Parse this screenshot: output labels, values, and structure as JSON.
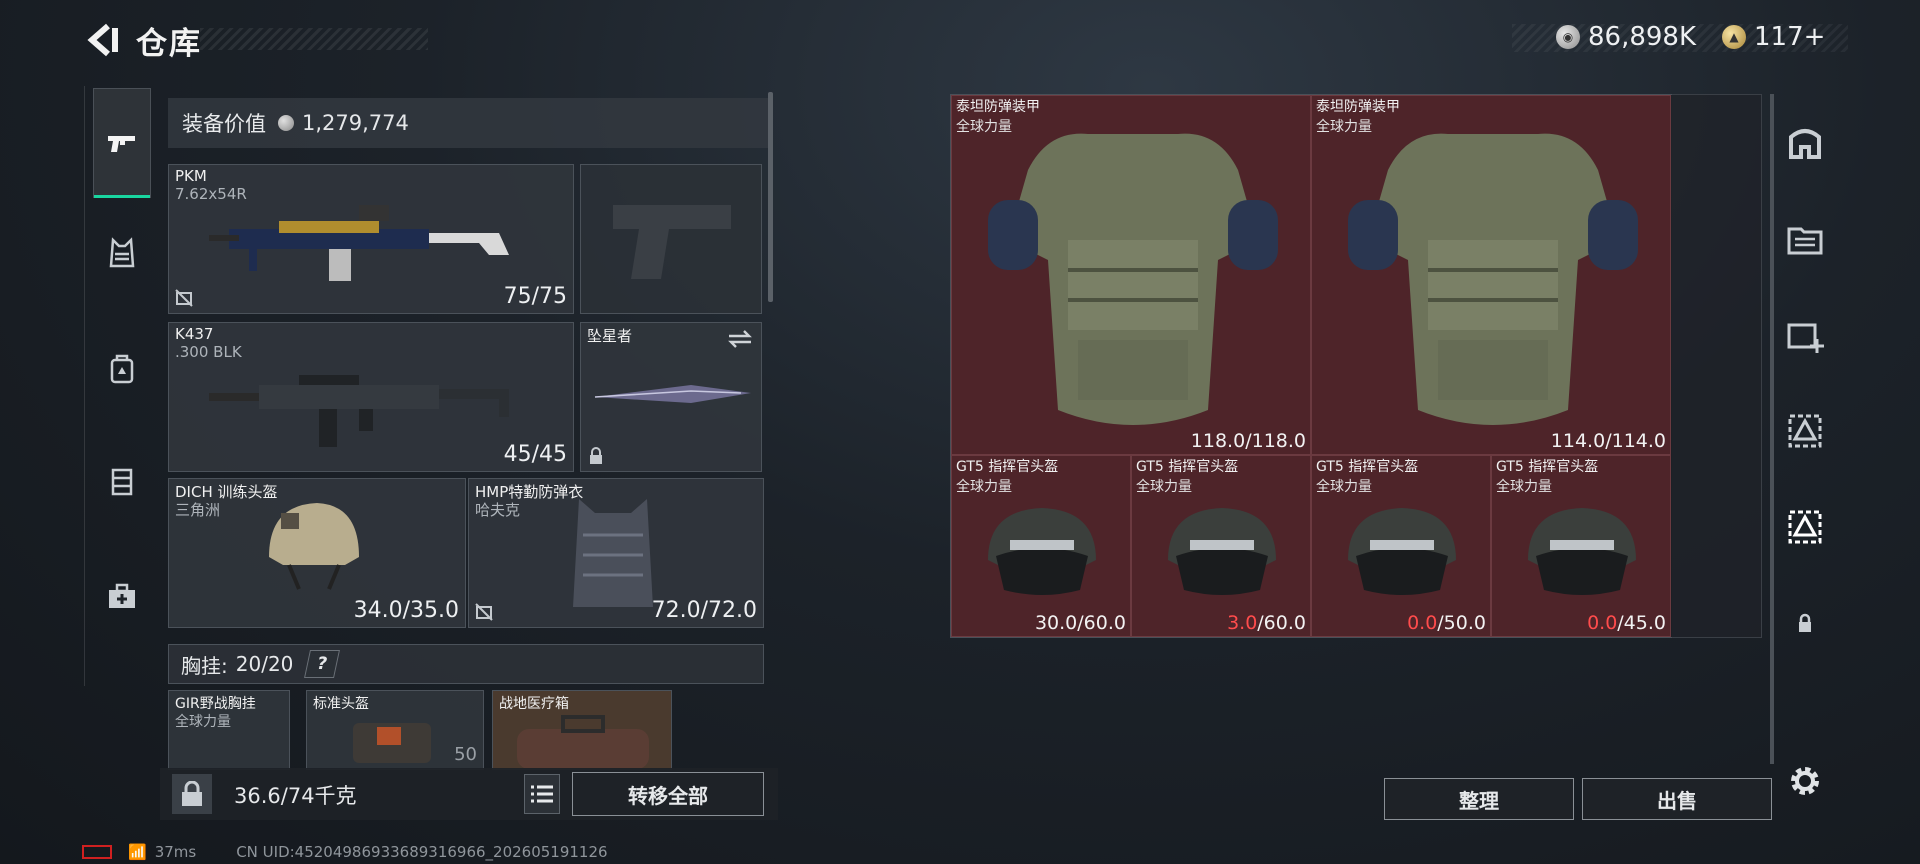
{
  "header": {
    "title": "仓库",
    "currency_silver": "86,898K",
    "currency_gold": "117+"
  },
  "categories": [
    {
      "icon": "pistol-icon",
      "active": true
    },
    {
      "icon": "vest-icon",
      "active": false
    },
    {
      "icon": "backpack-icon",
      "active": false
    },
    {
      "icon": "pouch-icon",
      "active": false
    },
    {
      "icon": "medkit-icon",
      "active": false
    }
  ],
  "equipment": {
    "value_label": "装备价值",
    "value": "1,279,774",
    "primary": {
      "name": "PKM",
      "caliber": "7.62x54R",
      "ammo": "75/75"
    },
    "secondary": {
      "name": "K437",
      "caliber": ".300 BLK",
      "ammo": "45/45"
    },
    "melee": {
      "name": "坠星者"
    },
    "helmet": {
      "name": "DICH 训练头盔",
      "origin": "三角洲",
      "durability": "34.0/35.0"
    },
    "armor": {
      "name": "HMP特勤防弹衣",
      "origin": "哈夫克",
      "durability": "72.0/72.0"
    },
    "chest_rig": {
      "label": "胸挂:",
      "count": "20/20",
      "help": "?"
    },
    "rig_items": [
      {
        "name": "GIR野战胸挂",
        "origin": "全球力量"
      },
      {
        "name": "标准头盔",
        "durability": "50"
      },
      {
        "name": "战地医疗箱"
      }
    ],
    "weight": "36.6/74千克",
    "transfer_all": "转移全部"
  },
  "stash": {
    "items": [
      {
        "name": "泰坦防弹装甲",
        "origin": "全球力量",
        "cur": "118.0",
        "max": "/118.0",
        "low": false
      },
      {
        "name": "泰坦防弹装甲",
        "origin": "全球力量",
        "cur": "114.0",
        "max": "/114.0",
        "low": false
      },
      {
        "name": "GT5 指挥官头盔",
        "origin": "全球力量",
        "cur": "30.0",
        "max": "/60.0",
        "low": false
      },
      {
        "name": "GT5 指挥官头盔",
        "origin": "全球力量",
        "cur": "3.0",
        "max": "/60.0",
        "low": true
      },
      {
        "name": "GT5 指挥官头盔",
        "origin": "全球力量",
        "cur": "0.0",
        "max": "/50.0",
        "low": true
      },
      {
        "name": "GT5 指挥官头盔",
        "origin": "全球力量",
        "cur": "0.0",
        "max": "/45.0",
        "low": true
      }
    ],
    "sort_label": "整理",
    "sell_label": "出售"
  },
  "status": {
    "ping": "37ms",
    "uid": "CN UID:4520498693368931696​6_202605191126"
  },
  "colors": {
    "accent": "#19d6a0",
    "stash_cell": "#4e2429",
    "low_durability": "#ff4c4c"
  }
}
